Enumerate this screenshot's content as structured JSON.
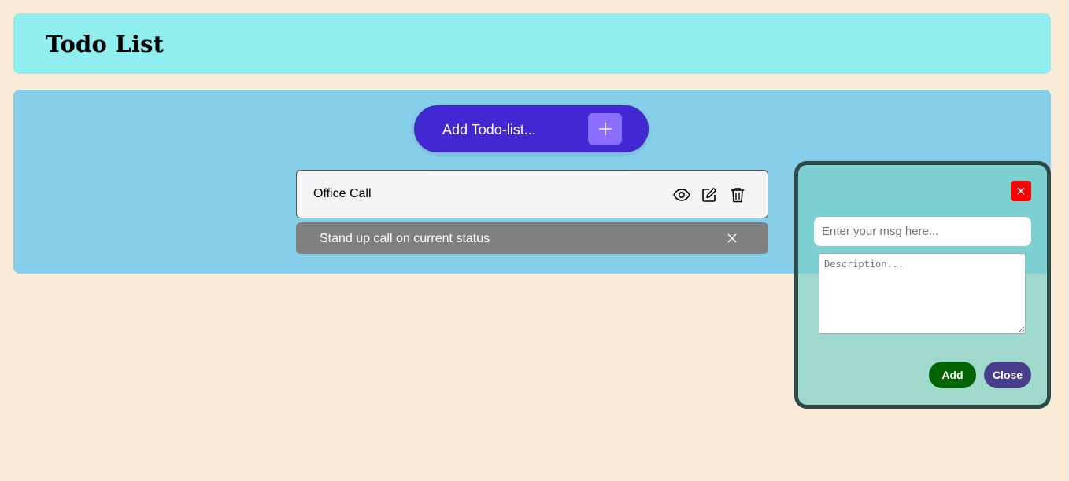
{
  "header": {
    "title": "Todo List"
  },
  "add_todo": {
    "label": "Add Todo-list...",
    "plus_icon": "plus-icon"
  },
  "todos": [
    {
      "title": "Office Call",
      "description": "Stand up call on current status",
      "actions": [
        "eye-icon",
        "edit-icon",
        "trash-icon"
      ]
    }
  ],
  "modal": {
    "close_icon": "close-icon",
    "msg_placeholder": "Enter your msg here...",
    "description_placeholder": "Description...",
    "add_label": "Add",
    "close_label": "Close"
  },
  "colors": {
    "page_bg": "#faebd7",
    "header_bg": "#90eeee",
    "panel_bg": "#87ceeb",
    "add_button_bg": "#4128d2",
    "add_button_plus_bg": "#8a6fff",
    "todo_card_bg": "#f4f4f4",
    "description_bar_bg": "#808080",
    "modal_close_bg": "#ff0000",
    "modal_add_bg": "#006400",
    "modal_closebtn_bg": "#483d8b"
  }
}
